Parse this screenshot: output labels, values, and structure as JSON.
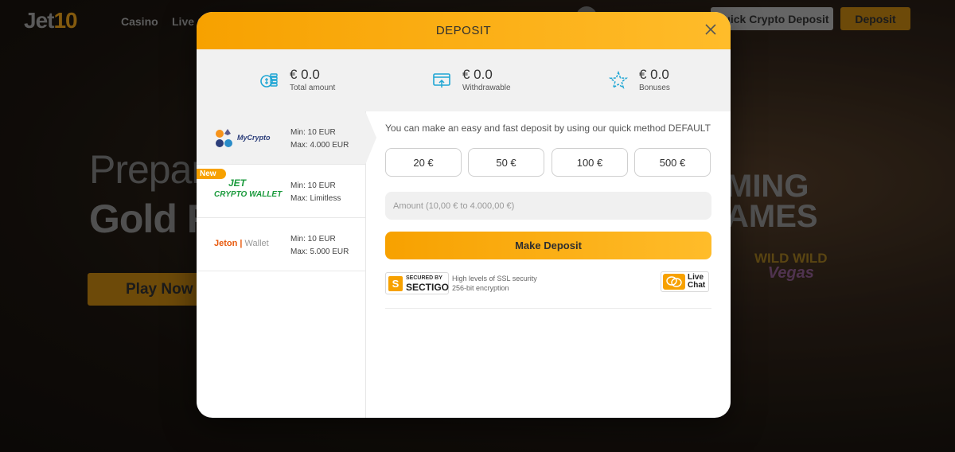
{
  "site": {
    "logo_main": "Jet",
    "logo_num": "10",
    "nav": [
      "Casino",
      "Live C"
    ],
    "quick_crypto_deposit": "Quick Crypto Deposit",
    "deposit": "Deposit",
    "hero_line1": "Prepar",
    "hero_line2": "Gold R",
    "play_now": "Play Now",
    "coming_line1": "MING",
    "coming_line2": "AMES",
    "game_logo_line1": "WILD WILD",
    "game_logo_line2": "Vegas"
  },
  "modal": {
    "title": "DEPOSIT",
    "balances": [
      {
        "value": "€ 0.0",
        "label": "Total amount",
        "icon": "coins-icon"
      },
      {
        "value": "€ 0.0",
        "label": "Withdrawable",
        "icon": "withdraw-icon"
      },
      {
        "value": "€ 0.0",
        "label": "Bonuses",
        "icon": "star-icon"
      }
    ],
    "methods": [
      {
        "name": "MyCrypto",
        "min": "Min: 10 EUR",
        "max": "Max: 4.000 EUR",
        "active": true
      },
      {
        "name_top": "JET",
        "name_bottom": "CRYPTO WALLET",
        "min": "Min: 10 EUR",
        "max": "Max: Limitless",
        "badge": "New"
      },
      {
        "name_a": "Jeton",
        "name_b": "Wallet",
        "min": "Min: 10 EUR",
        "max": "Max: 5.000 EUR"
      }
    ],
    "quick_text": "You can make an easy and fast deposit by using our quick method DEFAULT",
    "amounts": [
      "20 €",
      "50 €",
      "100 €",
      "500 €"
    ],
    "amount_placeholder": "Amount (10,00 € to 4.000,00 €)",
    "make_deposit": "Make Deposit",
    "sectigo_line1": "SECURED BY",
    "sectigo_line2": "SECTIGO",
    "ssl_line1": "High levels of SSL security",
    "ssl_line2": "256-bit encryption",
    "live_chat_line1": "Live",
    "live_chat_line2": "Chat"
  },
  "colors": {
    "accent": "#f7a100",
    "accent_light": "#ffbc2a",
    "icon_blue": "#1fa6d4",
    "wallet_green": "#1a9a3c",
    "jeton_orange": "#e8590c"
  }
}
